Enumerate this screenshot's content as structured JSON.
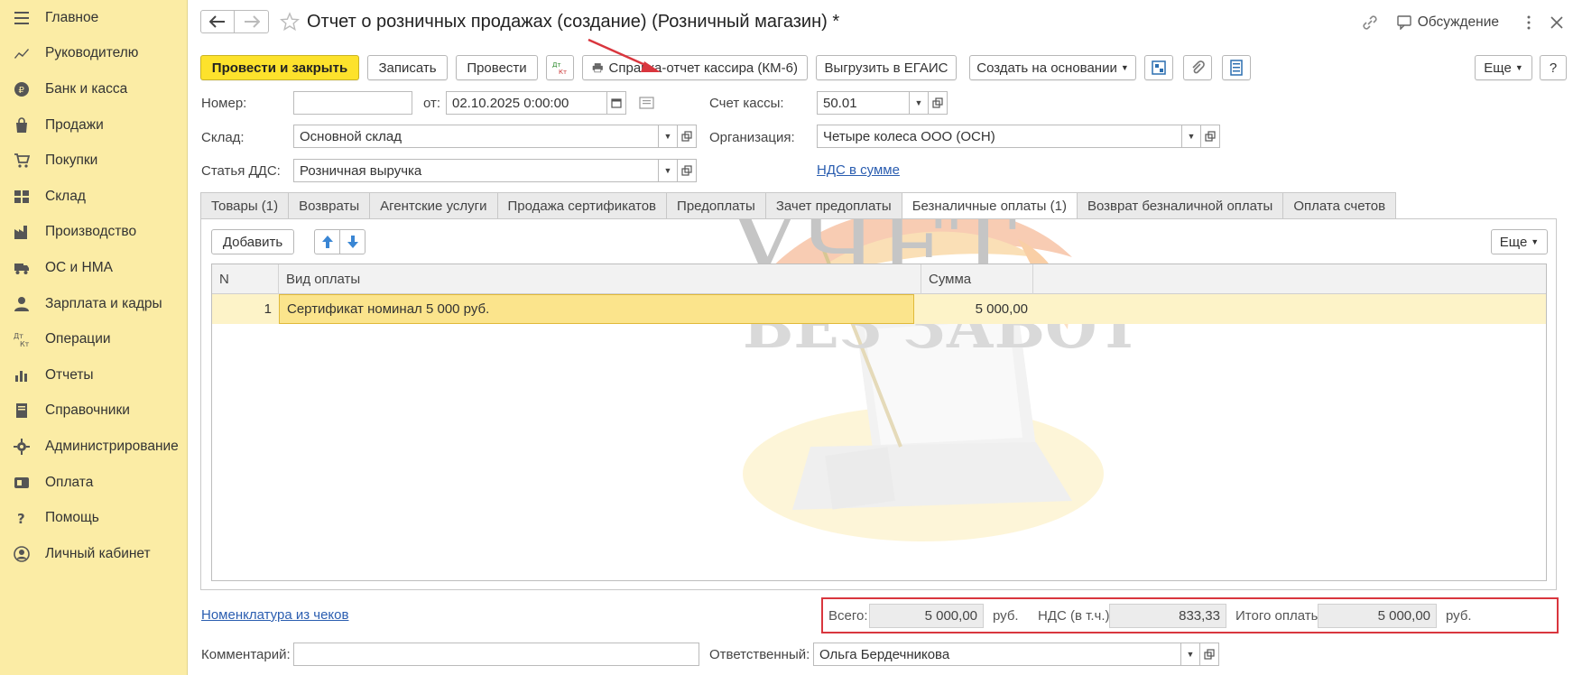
{
  "sidebar": {
    "items": [
      {
        "label": "Главное",
        "icon": "menu-icon"
      },
      {
        "label": "Руководителю",
        "icon": "trend-icon"
      },
      {
        "label": "Банк и касса",
        "icon": "coin-icon"
      },
      {
        "label": "Продажи",
        "icon": "bag-icon"
      },
      {
        "label": "Покупки",
        "icon": "cart-icon"
      },
      {
        "label": "Склад",
        "icon": "warehouse-icon"
      },
      {
        "label": "Производство",
        "icon": "factory-icon"
      },
      {
        "label": "ОС и НМА",
        "icon": "truck-icon"
      },
      {
        "label": "Зарплата и кадры",
        "icon": "person-icon"
      },
      {
        "label": "Операции",
        "icon": "dtkt-icon"
      },
      {
        "label": "Отчеты",
        "icon": "chart-icon"
      },
      {
        "label": "Справочники",
        "icon": "book-icon"
      },
      {
        "label": "Администрирование",
        "icon": "gear-icon"
      },
      {
        "label": "Оплата",
        "icon": "payment-icon"
      },
      {
        "label": "Помощь",
        "icon": "question-icon"
      },
      {
        "label": "Личный кабинет",
        "icon": "account-icon"
      }
    ]
  },
  "header": {
    "title": "Отчет о розничных продажах (создание) (Розничный магазин) *",
    "discussion": "Обсуждение"
  },
  "toolbar": {
    "post_close": "Провести и закрыть",
    "save": "Записать",
    "post": "Провести",
    "dtkt": "Дт Кт",
    "cashier_report": "Справка-отчет кассира (КМ-6)",
    "egais": "Выгрузить в ЕГАИС",
    "create_based": "Создать на основании",
    "more": "Еще",
    "help": "?"
  },
  "form": {
    "number_label": "Номер:",
    "number_value": "",
    "from_label": "от:",
    "date_value": "02.10.2025  0:00:00",
    "cash_account_label": "Счет кассы:",
    "cash_account_value": "50.01",
    "warehouse_label": "Склад:",
    "warehouse_value": "Основной склад",
    "org_label": "Организация:",
    "org_value": "Четыре колеса ООО (ОСН)",
    "dds_label": "Статья ДДС:",
    "dds_value": "Розничная выручка",
    "vat_link": "НДС в сумме"
  },
  "tabs": [
    "Товары (1)",
    "Возвраты",
    "Агентские услуги",
    "Продажа сертификатов",
    "Предоплаты",
    "Зачет предоплаты",
    "Безналичные оплаты (1)",
    "Возврат безналичной оплаты",
    "Оплата счетов"
  ],
  "active_tab": "Безналичные оплаты (1)",
  "panel": {
    "add": "Добавить",
    "more": "Еще"
  },
  "table": {
    "headers": [
      "N",
      "Вид оплаты",
      "Сумма"
    ],
    "rows": [
      {
        "n": "1",
        "type": "Сертификат номинал 5 000 руб.",
        "sum": "5 000,00"
      }
    ]
  },
  "watermark": {
    "line1": "УЧЕТ",
    "line2": "БЕЗ ЗАБОТ"
  },
  "footer": {
    "nomenclature_link": "Номенклатура из чеков",
    "total_label": "Всего:",
    "total_value": "5 000,00",
    "currency1": "руб.",
    "vat_label": "НДС (в т.ч.):",
    "vat_value": "833,33",
    "paid_label": "Итого оплаты:",
    "paid_value": "5 000,00",
    "currency2": "руб.",
    "comment_label": "Комментарий:",
    "comment_value": "",
    "responsible_label": "Ответственный:",
    "responsible_value": "Ольга Бердечникова"
  },
  "colors": {
    "sidebar_bg": "#fbeca5",
    "primary_button": "#fde22c",
    "link": "#2a5db0",
    "highlight_border": "#d9363e",
    "row_selected": "#fbe48c"
  }
}
